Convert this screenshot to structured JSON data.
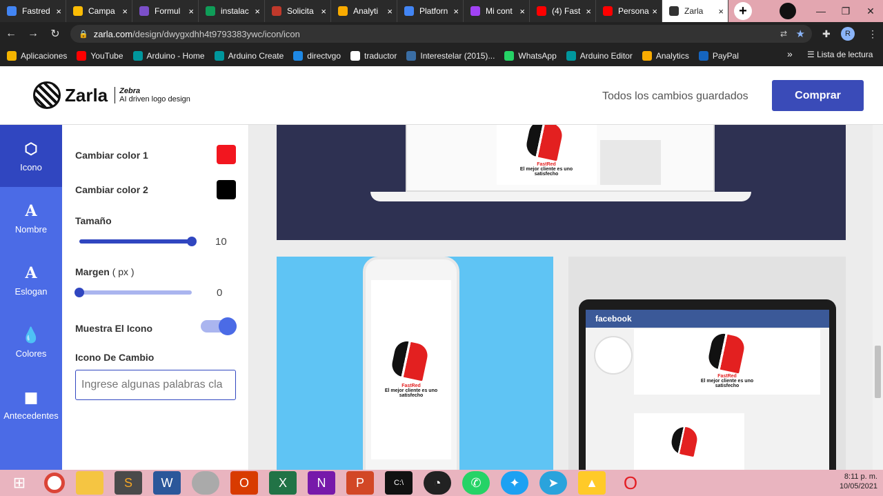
{
  "browser": {
    "tabs": [
      {
        "label": "Fastred",
        "color": "#4285f4"
      },
      {
        "label": "Campa",
        "color": "#fbbc05"
      },
      {
        "label": "Formul",
        "color": "#7b4fc9"
      },
      {
        "label": "instalac",
        "color": "#0f9d58"
      },
      {
        "label": "Solicita",
        "color": "#c0392b"
      },
      {
        "label": "Analyti",
        "color": "#f9ab00"
      },
      {
        "label": "Platforn",
        "color": "#4285f4"
      },
      {
        "label": "Mi cont",
        "color": "#a142f4"
      },
      {
        "label": "(4) Fast",
        "color": "#ff0000"
      },
      {
        "label": "Persona",
        "color": "#ff0000"
      },
      {
        "label": "Zarla",
        "color": "#333333"
      }
    ],
    "close_glyph": "×",
    "new_tab": "+",
    "url_host": "zarla.com",
    "url_path": "/design/dwygxdhh4t9793383ywc/icon/icon",
    "profile_initial": "R",
    "bookmarks": [
      {
        "label": "Aplicaciones",
        "icon": "grid-icon"
      },
      {
        "label": "YouTube",
        "icon": "youtube-icon"
      },
      {
        "label": "Arduino - Home",
        "icon": "arduino-icon"
      },
      {
        "label": "Arduino Create",
        "icon": "arduino-icon"
      },
      {
        "label": "directvgo",
        "icon": "directv-icon"
      },
      {
        "label": "traductor",
        "icon": "google-icon"
      },
      {
        "label": "Interestelar (2015)...",
        "icon": "film-icon"
      },
      {
        "label": "WhatsApp",
        "icon": "whatsapp-icon"
      },
      {
        "label": "Arduino Editor",
        "icon": "arduino-icon"
      },
      {
        "label": "Analytics",
        "icon": "analytics-icon"
      },
      {
        "label": "PayPal",
        "icon": "paypal-icon"
      }
    ],
    "more": "»",
    "reading_list": "Lista de lectura"
  },
  "header": {
    "brand": "Zarla",
    "sub_brand": "Zebra",
    "tagline": "AI driven logo design",
    "saved_status": "Todos los cambios guardados",
    "buy_label": "Comprar"
  },
  "sidenav": [
    {
      "label": "Icono",
      "icon": "icon-shapes-icon",
      "active": true
    },
    {
      "label": "Nombre",
      "icon": "letter-a-icon"
    },
    {
      "label": "Eslogan",
      "icon": "letter-a-icon"
    },
    {
      "label": "Colores",
      "icon": "drop-icon"
    },
    {
      "label": "Antecedentes",
      "icon": "square-icon"
    }
  ],
  "panel": {
    "color1_label": "Cambiar color 1",
    "color1": "#f2161f",
    "color2_label": "Cambiar color 2",
    "color2": "#000000",
    "size_label": "Tamaño",
    "size_value": "10",
    "size_fraction": 1.0,
    "margin_label": "Margen",
    "margin_unit": "( px )",
    "margin_value": "0",
    "margin_fraction": 0.0,
    "show_icon_label": "Muestra El Icono",
    "show_icon_on": true,
    "change_icon_label": "Icono De Cambio",
    "search_placeholder": "Ingrese algunas palabras cla"
  },
  "preview": {
    "brand_name": "FastRed",
    "slogan": "El mejor cliente es uno satisfecho",
    "fb_title": "facebook"
  },
  "colors": {
    "accent": "#3046c0",
    "nav": "#4b6be6",
    "red": "#e32020"
  },
  "taskbar": {
    "time": "8:11 p. m.",
    "date": "10/05/2021"
  }
}
